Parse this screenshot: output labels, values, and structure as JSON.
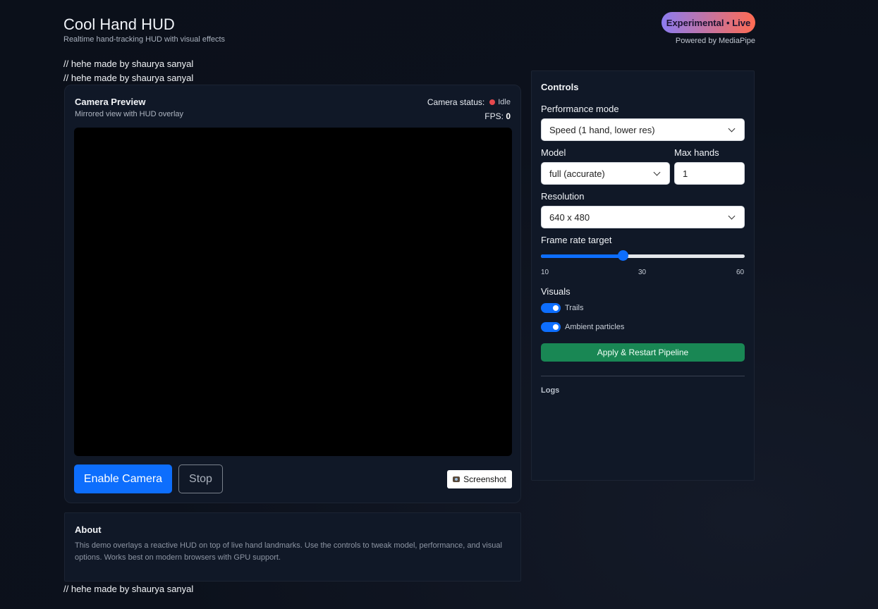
{
  "header": {
    "title": "Cool Hand HUD",
    "subtitle": "Realtime hand-tracking HUD with visual effects",
    "badge": "Experimental • Live",
    "powered_by": "Powered by MediaPipe"
  },
  "comments": {
    "line1": "// hehe made by shaurya sanyal",
    "line2": "// hehe made by shaurya sanyal",
    "line3": "// hehe made by shaurya sanyal"
  },
  "camera": {
    "title": "Camera Preview",
    "subtitle": "Mirrored view with HUD overlay",
    "status_label": "Camera status:",
    "status_value": "Idle",
    "status_color": "#e5484d",
    "fps_label": "FPS:",
    "fps_value": "0",
    "enable_label": "Enable Camera",
    "stop_label": "Stop",
    "screenshot_label": "Screenshot",
    "screenshot_icon": "camera-icon"
  },
  "about": {
    "title": "About",
    "text": "This demo overlays a reactive HUD on top of live hand landmarks. Use the controls to tweak model, performance, and visual options. Works best on modern browsers with GPU support."
  },
  "controls": {
    "title": "Controls",
    "performance_label": "Performance mode",
    "performance_value": "Speed (1 hand, lower res)",
    "model_label": "Model",
    "model_value": "full (accurate)",
    "max_hands_label": "Max hands",
    "max_hands_value": "1",
    "resolution_label": "Resolution",
    "resolution_value": "640 x 480",
    "framerate_label": "Frame rate target",
    "framerate": {
      "min": 10,
      "max": 60,
      "value": 30
    },
    "tick_min": "10",
    "tick_mid": "30",
    "tick_max": "60",
    "visuals_label": "Visuals",
    "trails_label": "Trails",
    "trails_on": true,
    "particles_label": "Ambient particles",
    "particles_on": true,
    "apply_label": "Apply & Restart Pipeline",
    "logs_label": "Logs"
  },
  "colors": {
    "accent": "#0d6efd",
    "apply": "#198754",
    "badge_start": "#8c7cf0",
    "badge_end": "#ff6b52"
  }
}
